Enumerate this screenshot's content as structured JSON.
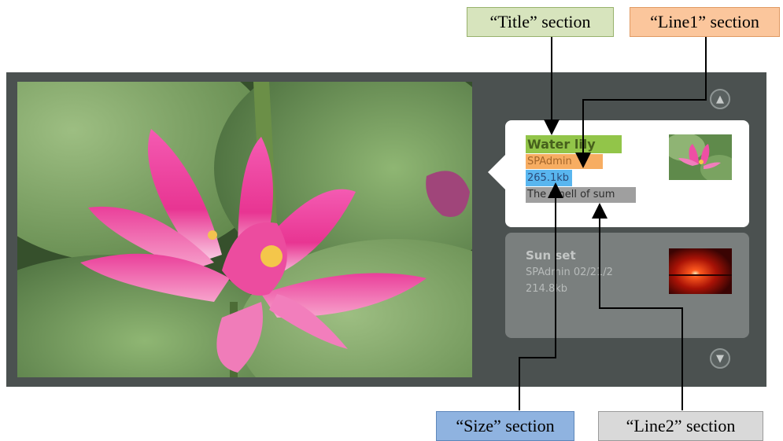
{
  "callouts": {
    "title": "“Title” section",
    "line1": "“Line1” section",
    "size": "“Size” section",
    "line2": "“Line2” section"
  },
  "slider": {
    "nav_up_icon": "chevron-up-circle-icon",
    "nav_down_icon": "chevron-down-circle-icon",
    "items": [
      {
        "title": "Water lily",
        "line1": "SPAdmin",
        "size": "265.1kb",
        "line2": "The smell of sum",
        "thumbnail": "water-lily-thumbnail",
        "active": true
      },
      {
        "title": "Sun set",
        "line1": "SPAdmin 02/21/2",
        "size": "214.8kb",
        "thumbnail": "sunset-thumbnail",
        "active": false
      }
    ]
  },
  "colors": {
    "widget_bg": "#4b5150",
    "title_highlight": "#92c549",
    "line1_highlight": "#f7ad62",
    "size_highlight": "#59b6ef",
    "line2_highlight": "#9f9f9f"
  }
}
